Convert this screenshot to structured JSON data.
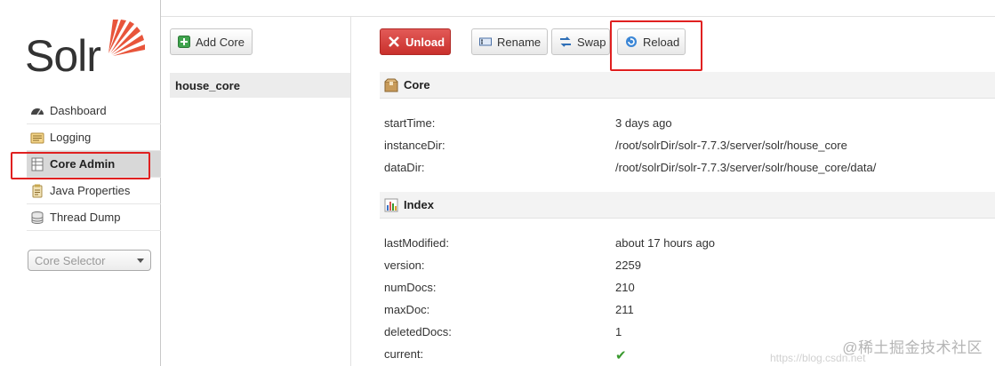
{
  "logo": {
    "text": "Solr"
  },
  "nav": {
    "items": [
      {
        "label": "Dashboard",
        "icon": "dashboard-icon",
        "active": false
      },
      {
        "label": "Logging",
        "icon": "logging-icon",
        "active": false
      },
      {
        "label": "Core Admin",
        "icon": "core-admin-icon",
        "active": true
      },
      {
        "label": "Java Properties",
        "icon": "java-properties-icon",
        "active": false
      },
      {
        "label": "Thread Dump",
        "icon": "thread-dump-icon",
        "active": false
      }
    ]
  },
  "core_selector": {
    "placeholder": "Core Selector"
  },
  "core_list": {
    "add_core_label": "Add Core",
    "cores": [
      "house_core"
    ]
  },
  "toolbar": {
    "unload_label": "Unload",
    "rename_label": "Rename",
    "swap_label": "Swap",
    "reload_label": "Reload"
  },
  "core_section": {
    "title": "Core",
    "rows": [
      {
        "key": "startTime:",
        "value": "3 days ago"
      },
      {
        "key": "instanceDir:",
        "value": "/root/solrDir/solr-7.7.3/server/solr/house_core"
      },
      {
        "key": "dataDir:",
        "value": "/root/solrDir/solr-7.7.3/server/solr/house_core/data/"
      }
    ]
  },
  "index_section": {
    "title": "Index",
    "rows": [
      {
        "key": "lastModified:",
        "value": "about 17 hours ago"
      },
      {
        "key": "version:",
        "value": "2259"
      },
      {
        "key": "numDocs:",
        "value": "210"
      },
      {
        "key": "maxDoc:",
        "value": "211"
      },
      {
        "key": "deletedDocs:",
        "value": "1"
      },
      {
        "key": "current:",
        "value": "✔"
      }
    ]
  },
  "watermark": {
    "text": "@稀土掘金技术社区",
    "url": "https://blog.csdn.net"
  },
  "colors": {
    "unload": "#d9534f",
    "highlight": "#e02020",
    "check": "#3a9a2f"
  }
}
